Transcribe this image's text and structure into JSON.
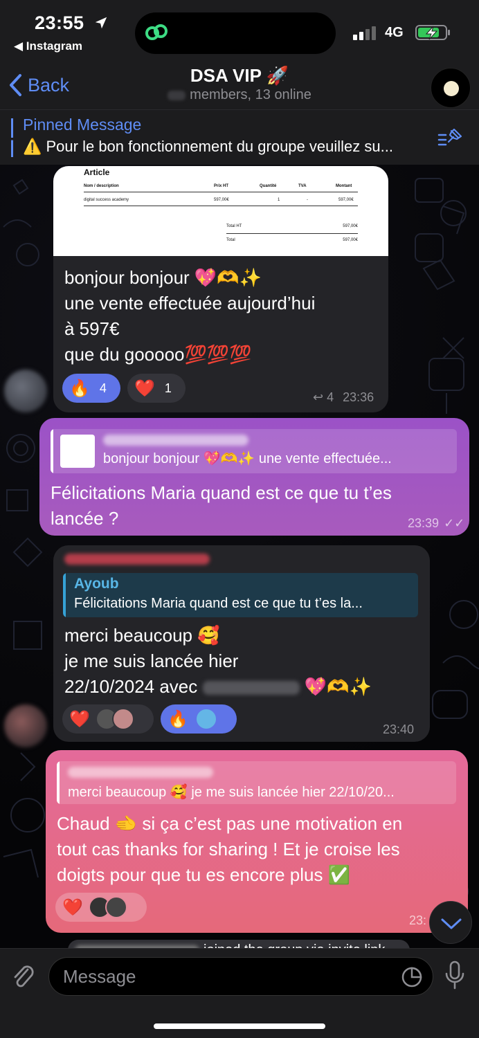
{
  "status": {
    "time": "23:55",
    "back_app": "◀ Instagram",
    "network": "4G"
  },
  "nav": {
    "back": "Back",
    "title": "DSA VIP 🚀",
    "subtitle": "members, 13 online"
  },
  "pinned": {
    "title": "Pinned Message",
    "text": "⚠️ Pour le bon fonctionnement du groupe veuillez su..."
  },
  "invoice": {
    "heading": "Article",
    "cols": [
      "Nom / description",
      "Prix HT",
      "Quantité",
      "TVA",
      "Montant"
    ],
    "row": [
      "digital success academy",
      "597,00€",
      "1",
      "-",
      "597,00€"
    ],
    "total_ht_label": "Total HT",
    "total_ht": "597,00€",
    "total_label": "Total",
    "total": "597,00€"
  },
  "msg1": {
    "lines": [
      "bonjour bonjour 💖🫶✨",
      "une vente effectuée aujourd’hui",
      "à 597€",
      "que du gooooo💯💯💯"
    ],
    "reactions": [
      {
        "emoji": "🔥",
        "count": "4"
      },
      {
        "emoji": "❤️",
        "count": "1"
      }
    ],
    "forwards": "4",
    "time": "23:36"
  },
  "msg2": {
    "reply_text": "bonjour bonjour 💖🫶✨ une vente effectuée...",
    "lines": [
      "Félicitations Maria quand est ce que tu t’es",
      "lancée ?"
    ],
    "time": "23:39"
  },
  "msg3": {
    "reply_author": "Ayoub",
    "reply_text": "Félicitations Maria quand est ce que tu t’es la...",
    "lines": [
      "merci beaucoup 🥰",
      "je me suis lancée hier",
      "22/10/2024 avec "
    ],
    "line_tail": "💖🫶✨",
    "reactions": [
      {
        "emoji": "❤️"
      },
      {
        "emoji": "🔥"
      }
    ],
    "time": "23:40"
  },
  "msg4": {
    "reply_text": "merci beaucoup 🥰 je me suis lancée hier 22/10/20...",
    "lines": [
      "Chaud 🫲 si ça c’est pas une motivation en",
      "tout cas thanks for sharing ! Et je croise les",
      "doigts pour que tu es encore plus ✅"
    ],
    "time": "23:"
  },
  "service": {
    "text": "joined the group via invite link"
  },
  "input": {
    "placeholder": "Message"
  },
  "colors": {
    "accent": "#5f8df5",
    "outgoing": "#9b52c7",
    "pink": "#e46a9a"
  }
}
